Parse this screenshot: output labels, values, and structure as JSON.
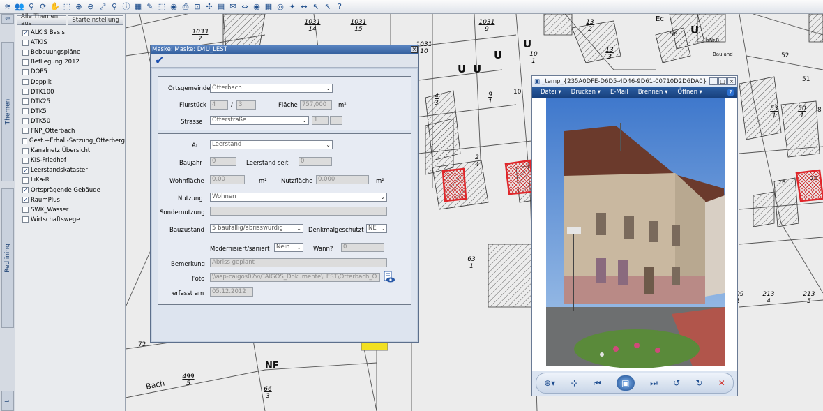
{
  "toolbar": {
    "icons": [
      "layers-icon",
      "people-icon",
      "binoculars-icon",
      "refresh-icon",
      "pan-hand-icon",
      "zoom-box-icon",
      "zoom-in-icon",
      "zoom-out-icon",
      "zoom-extent-icon",
      "person-search-icon",
      "info-icon",
      "map-layer-icon",
      "map-edit-icon",
      "map-select-icon",
      "eye-icon",
      "print-icon",
      "stamp-icon",
      "pointer-icon",
      "document-icon",
      "send-icon",
      "measure-icon",
      "eye-location-icon",
      "map-grid-icon",
      "search-map-icon",
      "map-pointer-icon",
      "measure-line-icon",
      "arrow-pick-icon",
      "arrow-clear-icon",
      "help-icon"
    ],
    "glyphs": [
      "≋",
      "👥",
      "⚲",
      "⟳",
      "✋",
      "⬚",
      "⊕",
      "⊖",
      "⤢",
      "⚲",
      "ⓘ",
      "▦",
      "✎",
      "⬚",
      "◉",
      "⎙",
      "⊡",
      "✣",
      "▤",
      "✉",
      "⇔",
      "◉",
      "▦",
      "◎",
      "✦",
      "↔",
      "↖",
      "↖",
      "?"
    ]
  },
  "side_tabs": {
    "themes": "Themen",
    "redlining": "Redlining",
    "bottom": "t"
  },
  "layer_panel": {
    "tab_all_off": "Alle Themen aus",
    "tab_default": "Starteinstellung",
    "layers": [
      {
        "label": "ALKIS Basis",
        "checked": true
      },
      {
        "label": "ATKIS",
        "checked": false
      },
      {
        "label": "Bebauungspläne",
        "checked": false
      },
      {
        "label": "Befliegung 2012",
        "checked": false
      },
      {
        "label": "DOP5",
        "checked": false
      },
      {
        "label": "Doppik",
        "checked": false
      },
      {
        "label": "DTK100",
        "checked": false
      },
      {
        "label": "DTK25",
        "checked": false
      },
      {
        "label": "DTK5",
        "checked": false
      },
      {
        "label": "DTK50",
        "checked": false
      },
      {
        "label": "FNP_Otterbach",
        "checked": false
      },
      {
        "label": "Gest.+Erhal.-Satzung_Otterberg",
        "checked": false
      },
      {
        "label": "Kanalnetz Übersicht",
        "checked": false
      },
      {
        "label": "KIS-Friedhof",
        "checked": false
      },
      {
        "label": "Leerstandskataster",
        "checked": true
      },
      {
        "label": "LiKa-R",
        "checked": false
      },
      {
        "label": "Ortsprägende Gebäude",
        "checked": true
      },
      {
        "label": "RaumPlus",
        "checked": true
      },
      {
        "label": "SWK_Wasser",
        "checked": false
      },
      {
        "label": "Wirtschaftswege",
        "checked": false
      }
    ]
  },
  "map_labels": [
    {
      "num": "1033",
      "den": "7"
    },
    {
      "num": "1031",
      "den": "14"
    },
    {
      "num": "1031",
      "den": "15"
    },
    {
      "num": "1031",
      "den": "9"
    },
    {
      "num": "1031",
      "den": "10"
    },
    {
      "num": "10",
      "den": "1"
    },
    {
      "num": "9",
      "den": "1"
    },
    {
      "num": "4",
      "den": "3"
    },
    {
      "num": "2",
      "den": "4"
    },
    {
      "num": "63",
      "den": "1"
    },
    {
      "num": "13",
      "den": "2"
    },
    {
      "num": "13",
      "den": "3"
    },
    {
      "num": "53",
      "den": "1"
    },
    {
      "num": "50",
      "den": "1"
    },
    {
      "num": "109",
      "den": "1"
    },
    {
      "num": "213",
      "den": "4"
    },
    {
      "num": "213",
      "den": "5"
    },
    {
      "num": "499",
      "den": "5"
    },
    {
      "num": "66",
      "den": "3"
    }
  ],
  "map_texts": {
    "u": "U",
    "nf": "NF",
    "bach": "Bach",
    "n72": "72",
    "n10": "10",
    "n52": "52",
    "n51": "51",
    "n56": "56",
    "n8": "8",
    "n16": "16",
    "n20": "20",
    "hsnr": "HsNr.8",
    "bauland": "Bauland",
    "ec": "Ec"
  },
  "mask": {
    "title": "Maske: Maske: D4U_LEST",
    "close": "×",
    "check": "✔",
    "fields": {
      "ortsgemeinde_label": "Ortsgemeinde",
      "ortsgemeinde_value": "Otterbach",
      "flurstueck_label": "Flurstück",
      "flurstueck_a": "4",
      "flurstueck_sep": "/",
      "flurstueck_b": "3",
      "flaeche_label": "Fläche",
      "flaeche_value": "757,000",
      "flaeche_unit": "m²",
      "strasse_label": "Strasse",
      "strasse_value": "Otterstraße",
      "strasse_nr": "1",
      "art_label": "Art",
      "art_value": "Leerstand",
      "baujahr_label": "Baujahr",
      "baujahr_value": "0",
      "leerstand_seit_label": "Leerstand seit",
      "leerstand_seit_value": "0",
      "wohnflaeche_label": "Wohnfläche",
      "wohnflaeche_value": "0,00",
      "wohnflaeche_unit": "m²",
      "nutzflaeche_label": "Nutzfläche",
      "nutzflaeche_value": "0,000",
      "nutzflaeche_unit": "m²",
      "nutzung_label": "Nutzung",
      "nutzung_value": "Wohnen",
      "sondernutzung_label": "Sondernutzung",
      "sondernutzung_value": "",
      "bauzustand_label": "Bauzustand",
      "bauzustand_value": "5 baufällig/abrisswürdig",
      "denkmal_label": "Denkmalgeschützt",
      "denkmal_value": "NE",
      "modernisiert_label": "Modernisiert/saniert",
      "modernisiert_value": "Nein",
      "wann_label": "Wann?",
      "wann_value": "0",
      "bemerkung_label": "Bemerkung",
      "bemerkung_value": "Abriss geplant",
      "foto_label": "Foto",
      "foto_value": "\\\\asp-caigos07v\\CAIGOS_Dokumente\\LEST\\Otterbach_O",
      "erfasst_label": "erfasst am",
      "erfasst_value": "05.12.2012"
    }
  },
  "viewer": {
    "title": "_temp_{235A0DFE-D6D5-4D46-9D61-00710D2D6DA0} - W...",
    "menu": [
      "Datei ▾",
      "Drucken ▾",
      "E-Mail",
      "Brennen ▾",
      "Öffnen ▾"
    ],
    "help": "?",
    "controls": [
      "⊕▾",
      "⊹",
      "⏮",
      "▣",
      "⏭",
      "↺",
      "↻",
      "✕"
    ]
  },
  "colors": {
    "highlight_parcel": "#e0262a",
    "title_blue": "#34609f",
    "marker_yellow": "#f2e022"
  }
}
